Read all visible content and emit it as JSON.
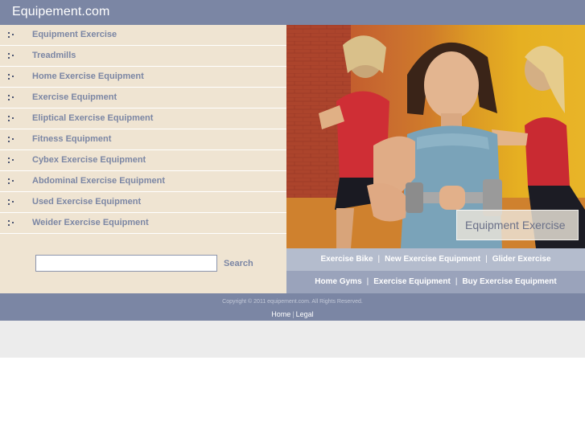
{
  "header": {
    "site_title": "Equipement.com"
  },
  "nav": {
    "items": [
      {
        "label": "Equipment Exercise"
      },
      {
        "label": "Treadmills"
      },
      {
        "label": "Home Exercise Equipment"
      },
      {
        "label": "Exercise Equipment"
      },
      {
        "label": "Eliptical Exercise Equipment"
      },
      {
        "label": "Fitness Equipment"
      },
      {
        "label": "Cybex Exercise Equipment"
      },
      {
        "label": "Abdominal Exercise Equipment"
      },
      {
        "label": "Used Exercise Equipment"
      },
      {
        "label": "Weider Exercise Equipment"
      }
    ]
  },
  "search": {
    "value": "",
    "button_label": "Search"
  },
  "hero": {
    "caption": "Equipment Exercise"
  },
  "links_row1": [
    "Exercise Bike",
    "New Exercise Equipment",
    "Glider Exercise"
  ],
  "links_row2": [
    "Home Gyms",
    "Exercise Equipment",
    "Buy Exercise Equipment"
  ],
  "link_separator": "|",
  "footer": {
    "copyright": "Copyright © 2011 equipement.com. All Rights Reserved.",
    "home_label": "Home",
    "separator": "|",
    "legal_label": "Legal"
  },
  "colors": {
    "header_bg": "#7b86a4",
    "sidebar_bg": "#efe4d2",
    "link_text": "#7b86a4",
    "link_bar_light": "#b4bccd",
    "link_bar_dark": "#9aa3bb",
    "band_grey": "#ececec"
  }
}
